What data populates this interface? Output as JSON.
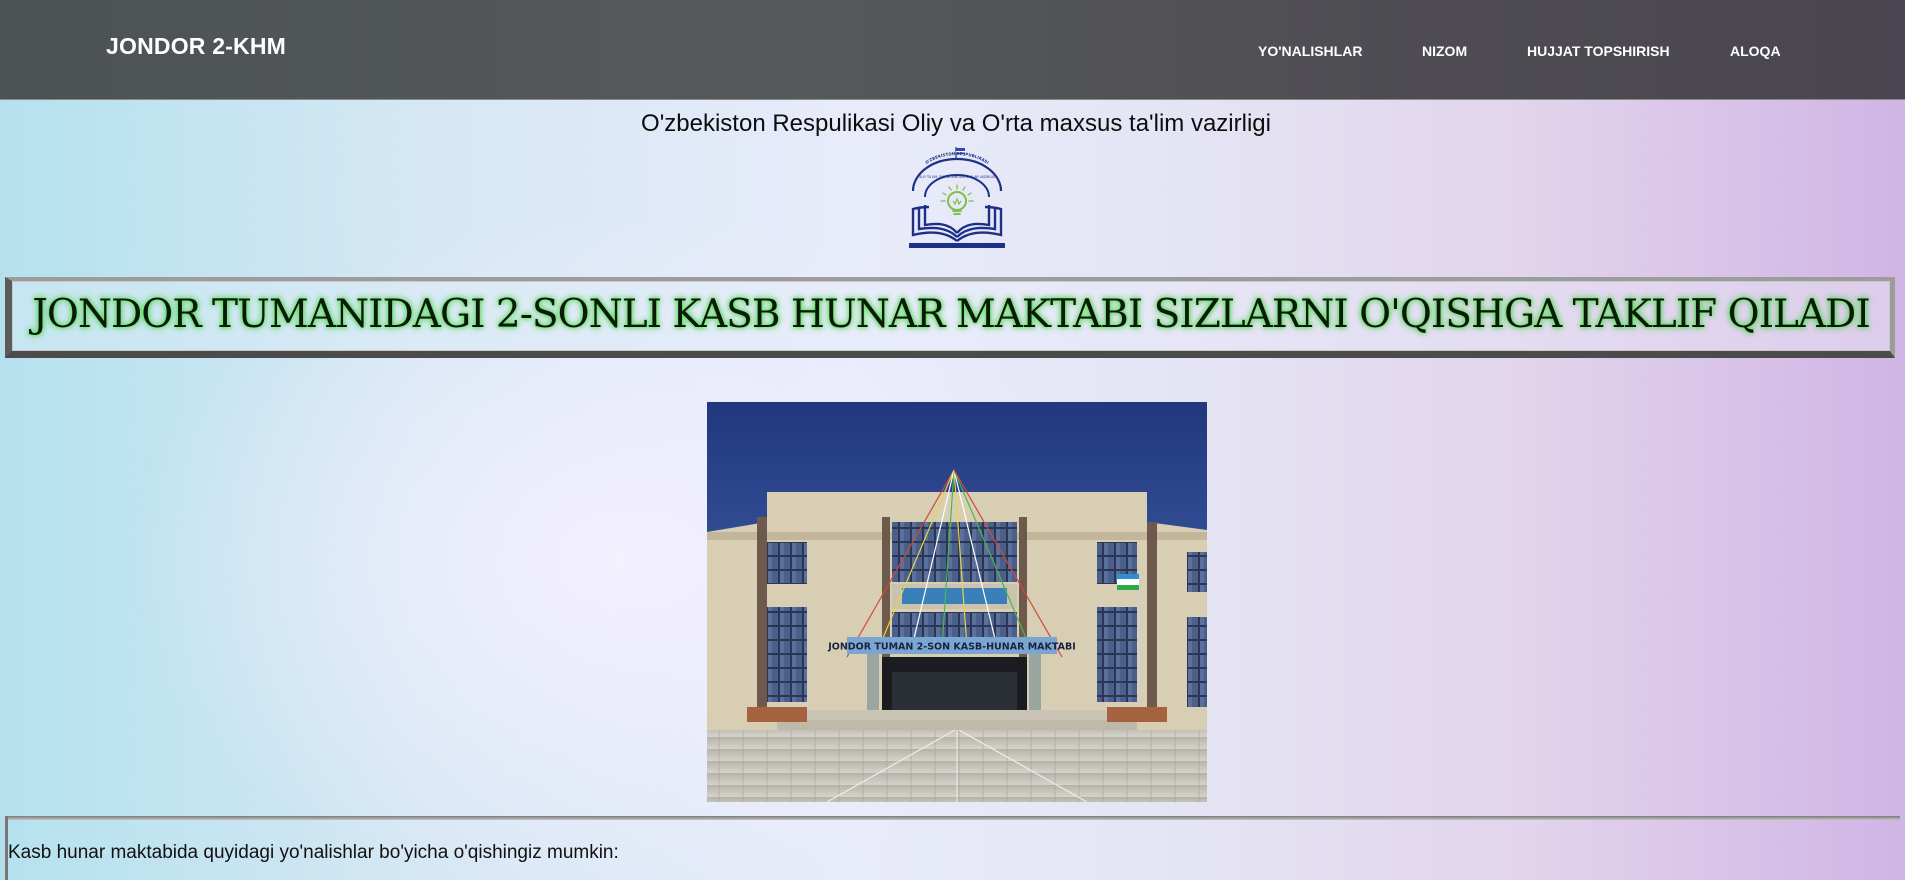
{
  "header": {
    "brand": "JONDOR 2-KHM",
    "nav": [
      "YO'NALISHLAR",
      "NIZOM",
      "HUJJAT TOPSHIRISH",
      "ALOQA"
    ]
  },
  "ministry_title": "O'zbekiston Respulikasi Oliy va O'rta maxsus ta'lim vazirligi",
  "logo": {
    "icon": "ministry-emblem-icon",
    "lines": [
      "O'ZBEKISTON RESPUBLIKASI",
      "OLIY TA'LIM, FAN VA INNOVATSIYALAR VAZIRLIGI"
    ]
  },
  "banner_text": "JONDOR TUMANIDAGI 2-SONLI KASB HUNAR MAKTABI SIZLARNI O'QISHGA TAKLIF QILADI",
  "school_photo": {
    "sign_text": "JONDOR TUMAN 2-SON KASB-HUNAR MAKTABI"
  },
  "intro_text": "Kasb hunar maktabida quyidagi yo'nalishlar bo'yicha o'qishingiz mumkin:",
  "colors": {
    "navbar": "#52575a",
    "emblem_blue": "#1d2f86",
    "emblem_green": "#7dc04b",
    "banner_glow": "#3fcf3f"
  }
}
